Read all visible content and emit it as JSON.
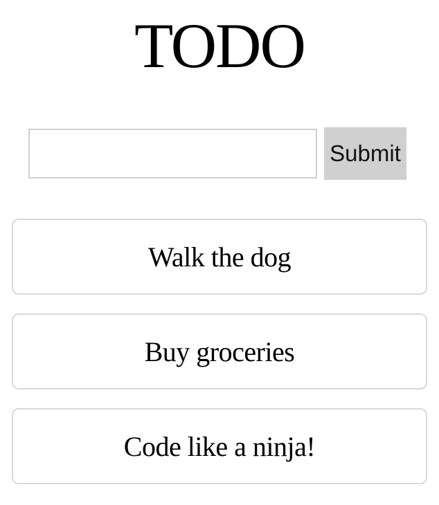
{
  "page": {
    "title": "TODO"
  },
  "form": {
    "input_value": "",
    "submit_label": "Submit"
  },
  "todos": [
    {
      "text": "Walk the dog"
    },
    {
      "text": "Buy groceries"
    },
    {
      "text": "Code like a ninja!"
    }
  ],
  "colors": {
    "button_background": "#d0d0d0",
    "input_border": "#cfcfcf",
    "item_border": "#d9d9d9"
  }
}
